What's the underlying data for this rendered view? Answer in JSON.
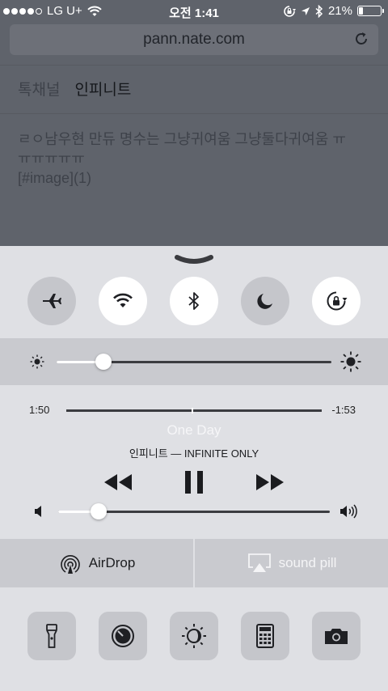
{
  "status_bar": {
    "carrier": "LG U+",
    "time": "오전 1:41",
    "battery_percent": "21%",
    "battery_level": 0.21,
    "signal_bars": 4,
    "signal_max": 5
  },
  "browser": {
    "url": "pann.nate.com"
  },
  "page": {
    "nav_tabs": [
      "톡채널",
      "인피니트"
    ],
    "post_text_line1": "ㄹㅇ남우현 만듀 명수는 그냥귀여움 그냥둘다귀여움 ㅠ",
    "post_text_line2": "ㅠㅠㅠㅠㅠ",
    "post_text_line3": "[#image](1)"
  },
  "control_center": {
    "toggles": [
      {
        "name": "airplane-mode",
        "icon": "airplane-icon",
        "on": false
      },
      {
        "name": "wifi",
        "icon": "wifi-icon",
        "on": true
      },
      {
        "name": "bluetooth",
        "icon": "bluetooth-icon",
        "on": true
      },
      {
        "name": "do-not-disturb",
        "icon": "moon-icon",
        "on": false
      },
      {
        "name": "rotation-lock",
        "icon": "rotation-lock-icon",
        "on": true
      }
    ],
    "brightness_level": 0.17,
    "media": {
      "elapsed": "1:50",
      "remaining": "-1:53",
      "progress": 0.49,
      "song_title": "One Day",
      "artist_album": "인피니트 — INFINITE ONLY",
      "volume_level": 0.15
    },
    "airdrop_label": "AirDrop",
    "airplay_label": "sound pill",
    "shortcuts": [
      {
        "name": "flashlight",
        "icon": "flashlight-icon"
      },
      {
        "name": "timer",
        "icon": "timer-icon"
      },
      {
        "name": "night-shift",
        "icon": "night-shift-icon"
      },
      {
        "name": "calculator",
        "icon": "calculator-icon"
      },
      {
        "name": "camera",
        "icon": "camera-icon"
      }
    ]
  }
}
